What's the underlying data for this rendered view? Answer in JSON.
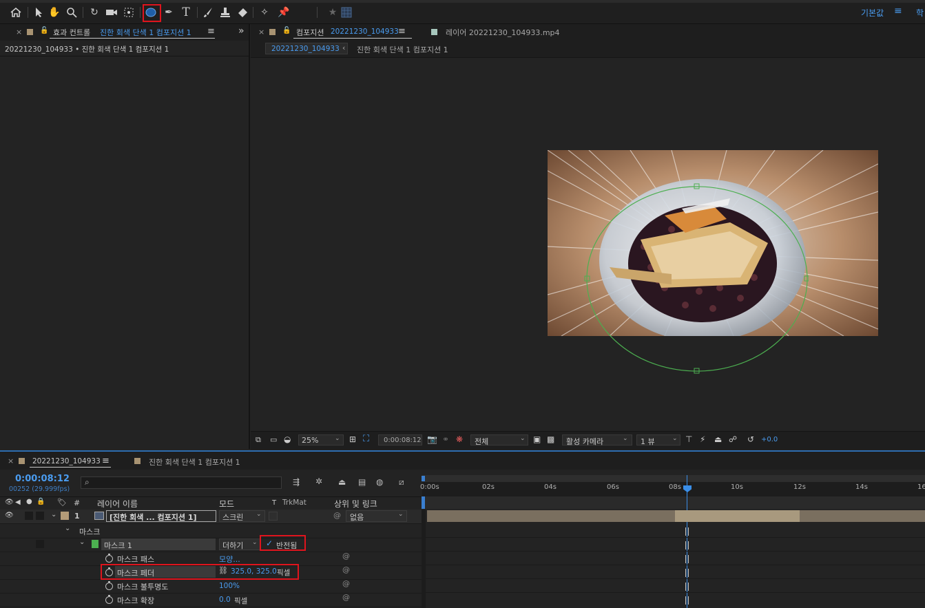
{
  "toolbar": {
    "workspace_label": "기본값",
    "menu_icon": "hamburger-icon",
    "overflow_label": "학",
    "tools": [
      "home-icon",
      "selection-arrow-icon",
      "hand-icon",
      "zoom-icon",
      "rotate-icon",
      "camera-icon",
      "pan-behind-icon",
      "ellipse-tool-icon",
      "pen-icon",
      "text-icon",
      "brush-icon",
      "clone-stamp-icon",
      "eraser-icon",
      "roto-brush-icon",
      "puppet-pin-icon",
      "star-icon",
      "grid-icon"
    ]
  },
  "effects_panel": {
    "close": "×",
    "tab_prefix": "효과 컨트롤",
    "tab_target": "진한 회색 단색 1 컴포지션 1",
    "menu": "≡",
    "expand": "»",
    "breadcrumb": "20221230_104933 • 진한 회색 단색 1 컴포지션 1"
  },
  "comp_panel": {
    "close": "×",
    "tab_prefix": "컴포지션",
    "tab_name": "20221230_104933",
    "menu": "≡",
    "layer_tab": "레이어 20221230_104933.mp4",
    "crumb_active": "20221230_104933",
    "crumb_arrow": "‹",
    "crumb_next": "진한 회색 단색 1 컴포지션 1"
  },
  "viewer_bar": {
    "zoom": "25%",
    "timecode": "0:00:08:12",
    "resolution": "전체",
    "camera": "활성 카메라",
    "views": "1 뷰",
    "exposure": "+0.0"
  },
  "timeline": {
    "close": "×",
    "comp_tab": "20221230_104933",
    "menu": "≡",
    "other_tab": "진한 회색 단색 1 컴포지션 1",
    "timecode": "0:00:08:12",
    "frames": "00252 (29.999fps)",
    "search_placeholder": "",
    "headers": {
      "hash": "#",
      "layer_name": "레이어 이름",
      "mode": "모드",
      "t": "T",
      "trkmat": "TrkMat",
      "parent": "상위 및 링크"
    },
    "ruler": [
      "0:00s",
      "02s",
      "04s",
      "06s",
      "08s",
      "10s",
      "12s",
      "14s",
      "16"
    ],
    "layer": {
      "index": "1",
      "name": "[진한 회색 ... 컴포지션 1]",
      "mode": "스크린",
      "parent": "없음"
    },
    "mask_group": "마스크",
    "mask": {
      "name": "마스크 1",
      "mode": "더하기",
      "inverted_label": "반전됨",
      "inverted_check": "✓"
    },
    "props": [
      {
        "name": "마스크 패스",
        "value": "모양...",
        "unit": ""
      },
      {
        "name": "마스크 페더",
        "value": "325.0, 325.0",
        "unit": "픽셀"
      },
      {
        "name": "마스크 불투명도",
        "value": "100%",
        "unit": ""
      },
      {
        "name": "마스크 확장",
        "value": "0.0",
        "unit": "픽셀"
      }
    ]
  },
  "colors": {
    "accent_blue": "#4a9cf0",
    "highlight_red": "#e0141d",
    "mask_green": "#4caf50",
    "layer_bar": "#7a6f5f"
  }
}
